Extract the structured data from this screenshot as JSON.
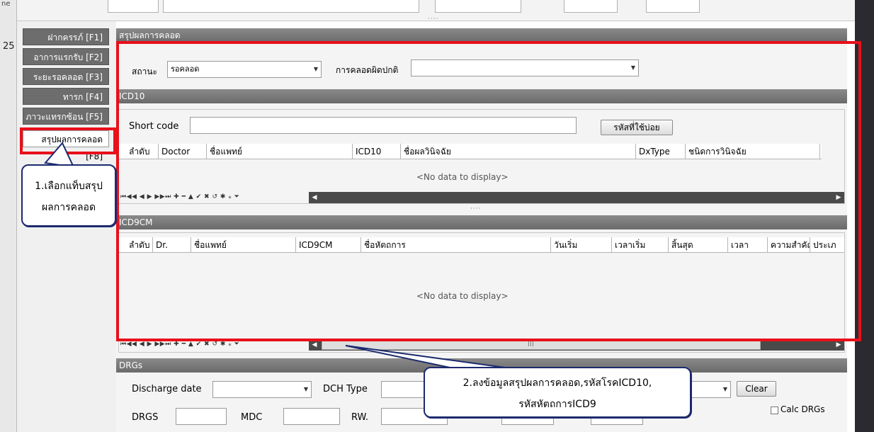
{
  "window": {
    "edge_left_text": "ne",
    "left_number": "25"
  },
  "topbar": {
    "splitter": "····"
  },
  "sidebar": {
    "tabs": [
      {
        "label": "ฝากครรภ์ [F1]"
      },
      {
        "label": "อาการแรกรับ [F2]"
      },
      {
        "label": "ระยะรอคลอด [F3]"
      },
      {
        "label": "ทารก [F4]"
      },
      {
        "label": "ภาวะแทรกซ้อน [F5]"
      },
      {
        "label": "สรุปผลการคลอด [F8]"
      }
    ]
  },
  "summary": {
    "header": "สรุปผลการคลอด",
    "status_label": "สถานะ",
    "status_value": "รอคลอด",
    "abnormal_label": "การคลอดผิดปกติ",
    "abnormal_value": ""
  },
  "icd10": {
    "header": "ICD10",
    "short_code_label": "Short code",
    "short_code_value": "",
    "frequent_button": "รหัสที่ใช้บ่อย",
    "columns": [
      "ลำดับ",
      "Doctor",
      "ชื่อแพทย์",
      "ICD10",
      "ชื่อผลวินิจฉัย",
      "DxType",
      "ชนิดการวินิจฉัย"
    ],
    "empty_text": "<No data to display>",
    "nav": "⏮◀◀ ◀ ▶ ▶▶⏭ ✚ ━ ▲ ✔ ✖ ↺ ✱ ⁎ ⏷"
  },
  "icd9cm": {
    "header": "ICD9CM",
    "columns": [
      "ลำดับ",
      "Dr.",
      "ชื่อแพทย์",
      "ICD9CM",
      "ชื่อหัตถการ",
      "วันเริ่ม",
      "เวลาเริ่ม",
      "สิ้นสุด",
      "เวลา",
      "ความสำคัญ",
      "ประเภ"
    ],
    "empty_text": "<No data to display>",
    "nav": "⏮◀◀ ◀ ▶ ▶▶⏭ ✚ ━ ▲ ✔ ✖ ↺ ✱ ⁎ ⏷",
    "scroll_grip": "|||"
  },
  "drgs": {
    "header": "DRGs",
    "discharge_date_label": "Discharge date",
    "discharge_date_value": "",
    "dch_type_label": "DCH Type",
    "clear_button": "Clear",
    "drgs_label": "DRGS",
    "mdc_label": "MDC",
    "rw_label": "RW.",
    "calc_drgs_label": "Calc DRGs"
  },
  "annotations": {
    "callout1_line1": "1.เลือกแท็บสรุป",
    "callout1_line2": "ผลการคลอด",
    "callout2_line1": "2.ลงข้อมูลสรุปผลการคลอด,รหัสโรคICD10,",
    "callout2_line2": "รหัสหัตถการICD9"
  },
  "colors": {
    "annotation_red": "#e8101a",
    "callout_border": "#1c2a6e",
    "header_gray": "#6a6a6a"
  }
}
